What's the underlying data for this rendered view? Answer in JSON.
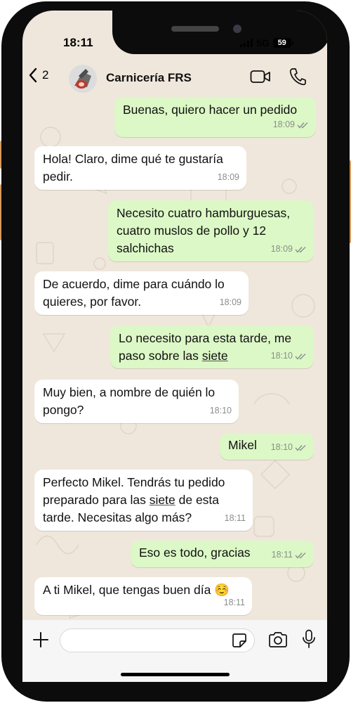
{
  "status_bar": {
    "time": "18:11",
    "network": "5G",
    "battery": "59"
  },
  "header": {
    "back_count": "2",
    "chat_name": "Carnicería FRS"
  },
  "messages": [
    {
      "dir": "out",
      "text": "Buenas, quiero hacer un pedido",
      "time": "18:09",
      "read": true
    },
    {
      "dir": "in",
      "text": "Hola! Claro, dime qué te gustaría\npedir.",
      "time": "18:09"
    },
    {
      "dir": "out",
      "text": "Necesito cuatro hamburguesas,\ncuatro muslos de pollo y 12\nsalchichas",
      "time": "18:09",
      "read": true
    },
    {
      "dir": "in",
      "text": "De acuerdo, dime para cuándo lo\nquieres, por favor.",
      "time": "18:09"
    },
    {
      "dir": "out",
      "text_a": "Lo necesito para esta tarde, me\npaso sobre las ",
      "text_link": "siete",
      "time": "18:10",
      "read": true
    },
    {
      "dir": "in",
      "text": "Muy bien, a nombre de quién lo\npongo?",
      "time": "18:10"
    },
    {
      "dir": "out",
      "text": "Mikel",
      "time": "18:10",
      "read": true
    },
    {
      "dir": "in",
      "text_a": "Perfecto Mikel. Tendrás tu pedido\npreparado para las ",
      "text_link": "siete",
      "text_b": " de esta\ntarde. Necesitas algo más?",
      "time": "18:11"
    },
    {
      "dir": "out",
      "text": "Eso es todo, gracias",
      "time": "18:11",
      "read": true
    },
    {
      "dir": "in",
      "text": "A ti Mikel, que tengas buen día ☺️",
      "time": "18:11"
    }
  ],
  "composer": {
    "placeholder": ""
  },
  "icons": {
    "back": "chevron-left-icon",
    "video": "video-camera-icon",
    "call": "phone-icon",
    "plus": "plus-icon",
    "sticker": "sticker-icon",
    "camera": "camera-icon",
    "mic": "microphone-icon",
    "read_receipt": "double-check-icon"
  },
  "colors": {
    "outgoing_bubble": "#dcf8c6",
    "incoming_bubble": "#ffffff",
    "wallpaper": "#efe7dc",
    "timestamp": "#8a8f8c"
  }
}
